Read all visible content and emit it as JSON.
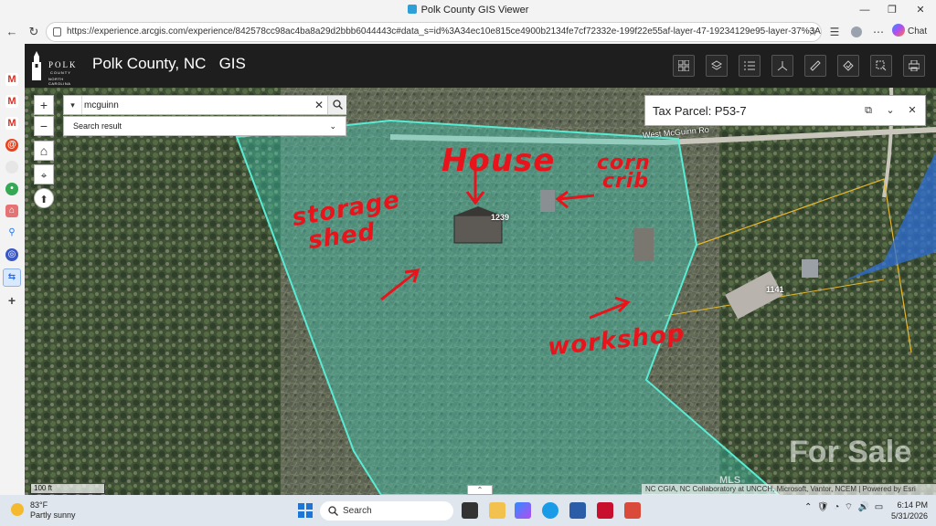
{
  "browser": {
    "tab_title": "Polk County GIS Viewer",
    "url": "https://experience.arcgis.com/experience/842578cc98ac4ba8a29d2bbb6044443c#data_s=id%3A34ec10e815ce4900b2134fe7cf72332e-199f22e55af-layer-47-19234129e95-layer-37%3A1847",
    "chat_label": "Chat"
  },
  "app": {
    "title": "Polk County, NC   GIS",
    "logo": {
      "line1": "POLK",
      "line2": "COUNTY",
      "line3": "NORTH CAROLINA"
    },
    "header_tools": [
      "grid-icon",
      "layers-icon",
      "list-icon",
      "share-icon",
      "measure-icon",
      "bookmark-icon",
      "select-icon",
      "print-icon"
    ]
  },
  "search": {
    "value": "mcguinn",
    "result_label": "Search result"
  },
  "parcel_panel": {
    "title": "Tax Parcel: P53-7"
  },
  "map": {
    "road_label": "West McGuinn Ro",
    "parcel_numbers": [
      "1239",
      "1141"
    ],
    "scale_label": "100 ft",
    "attribution": "NC CGIA, NC Collaboratory at UNCCH, Microsoft, Vantor, NCEM | Powered by Esri",
    "watermark": "For Sale",
    "watermark2": "MLS",
    "annotations": {
      "house": "House",
      "corn_crib_1": "corn",
      "corn_crib_2": "crib",
      "storage_1": "storage",
      "storage_2": "shed",
      "workshop": "workshop"
    }
  },
  "taskbar": {
    "weather_temp": "83°F",
    "weather_desc": "Partly sunny",
    "search_placeholder": "Search",
    "time": "6:14 PM",
    "date": "5/31/2026"
  }
}
